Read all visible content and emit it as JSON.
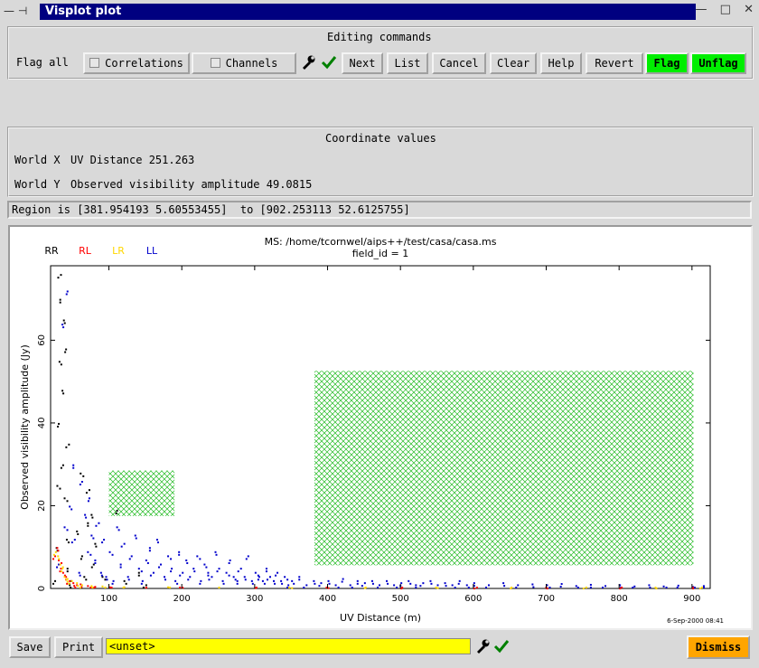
{
  "window": {
    "title": "Visplot plot",
    "left_controls": "— ⊣",
    "right_controls": [
      "—",
      "□",
      "✕"
    ]
  },
  "editing": {
    "heading": "Editing commands",
    "flag_all_label": "Flag all",
    "correlations_label": "Correlations",
    "channels_label": "Channels",
    "buttons": {
      "next": "Next",
      "list": "List",
      "cancel": "Cancel",
      "clear": "Clear",
      "help": "Help",
      "revert": "Revert",
      "flag": "Flag",
      "unflag": "Unflag"
    }
  },
  "coords": {
    "heading": "Coordinate values",
    "world_x_label": "World X",
    "world_x_value": "UV Distance 251.263",
    "world_y_label": "World Y",
    "world_y_value": "Observed visibility amplitude 49.0815"
  },
  "region_text": "Region is [381.954193 5.60553455]  to [902.253113 52.6125755]",
  "chart_data": {
    "type": "scatter",
    "title": "MS: /home/tcornwel/aips++/test/casa/casa.ms",
    "subtitle": "field_id = 1",
    "xlabel": "UV Distance (m)",
    "ylabel": "Observed visibility amplitude (Jy)",
    "xlim": [
      20,
      925
    ],
    "ylim": [
      0,
      78
    ],
    "x_ticks": [
      100,
      200,
      300,
      400,
      500,
      600,
      700,
      800,
      900
    ],
    "y_ticks": [
      0,
      20,
      40,
      60
    ],
    "legend": [
      {
        "name": "RR",
        "color": "#000000"
      },
      {
        "name": "RL",
        "color": "#ff0000"
      },
      {
        "name": "LR",
        "color": "#ffd700"
      },
      {
        "name": "LL",
        "color": "#0000cc"
      }
    ],
    "legend_placement": "top-left",
    "flag_regions": [
      {
        "x": [
          100,
          190
        ],
        "y": [
          17.5,
          28.5
        ]
      },
      {
        "x": [
          382,
          902
        ],
        "y": [
          5.6,
          52.6
        ]
      }
    ],
    "series": [
      {
        "name": "RR",
        "color": "#000000",
        "points": [
          [
            25,
            2
          ],
          [
            27,
            10
          ],
          [
            28,
            25
          ],
          [
            30,
            40
          ],
          [
            31,
            55
          ],
          [
            32,
            70
          ],
          [
            33,
            76
          ],
          [
            35,
            48
          ],
          [
            36,
            30
          ],
          [
            37,
            65
          ],
          [
            38,
            22
          ],
          [
            40,
            58
          ],
          [
            41,
            12
          ],
          [
            42,
            5
          ],
          [
            44,
            35
          ],
          [
            45,
            1
          ],
          [
            47,
            2
          ],
          [
            55,
            14
          ],
          [
            60,
            28
          ],
          [
            62,
            8
          ],
          [
            65,
            3
          ],
          [
            70,
            16
          ],
          [
            72,
            24
          ],
          [
            75,
            18
          ],
          [
            78,
            6
          ],
          [
            80,
            11
          ],
          [
            90,
            3
          ],
          [
            110,
            19
          ],
          [
            120,
            2
          ],
          [
            140,
            4
          ],
          [
            150,
            1
          ]
        ]
      },
      {
        "name": "LL",
        "color": "#0000cc",
        "points": [
          [
            30,
            6
          ],
          [
            35,
            64
          ],
          [
            38,
            15
          ],
          [
            42,
            72
          ],
          [
            45,
            20
          ],
          [
            50,
            30
          ],
          [
            52,
            12
          ],
          [
            58,
            4
          ],
          [
            62,
            26
          ],
          [
            66,
            18
          ],
          [
            70,
            9
          ],
          [
            72,
            22
          ],
          [
            75,
            13
          ],
          [
            80,
            7
          ],
          [
            85,
            16
          ],
          [
            88,
            4
          ],
          [
            92,
            12
          ],
          [
            95,
            3
          ],
          [
            100,
            9
          ],
          [
            105,
            2
          ],
          [
            110,
            15
          ],
          [
            115,
            6
          ],
          [
            120,
            11
          ],
          [
            125,
            3
          ],
          [
            130,
            8
          ],
          [
            135,
            13
          ],
          [
            140,
            5
          ],
          [
            145,
            2
          ],
          [
            150,
            7
          ],
          [
            155,
            10
          ],
          [
            160,
            4
          ],
          [
            165,
            12
          ],
          [
            170,
            6
          ],
          [
            175,
            3
          ],
          [
            180,
            8
          ],
          [
            185,
            5
          ],
          [
            190,
            2
          ],
          [
            195,
            9
          ],
          [
            200,
            4
          ],
          [
            205,
            7
          ],
          [
            210,
            3
          ],
          [
            215,
            5
          ],
          [
            220,
            8
          ],
          [
            225,
            2
          ],
          [
            230,
            6
          ],
          [
            235,
            4
          ],
          [
            240,
            3
          ],
          [
            245,
            9
          ],
          [
            250,
            5
          ],
          [
            255,
            2
          ],
          [
            260,
            4
          ],
          [
            265,
            7
          ],
          [
            270,
            3
          ],
          [
            275,
            2
          ],
          [
            280,
            5
          ],
          [
            285,
            3
          ],
          [
            290,
            8
          ],
          [
            295,
            2
          ],
          [
            300,
            4
          ],
          [
            305,
            3
          ],
          [
            310,
            2
          ],
          [
            315,
            5
          ],
          [
            320,
            3
          ],
          [
            325,
            2
          ],
          [
            330,
            4
          ],
          [
            335,
            2
          ],
          [
            340,
            3
          ],
          [
            345,
            1
          ],
          [
            350,
            2
          ],
          [
            360,
            3
          ],
          [
            370,
            1
          ],
          [
            380,
            2
          ],
          [
            390,
            1.5
          ],
          [
            400,
            2
          ],
          [
            410,
            1
          ],
          [
            420,
            2.5
          ],
          [
            430,
            1
          ],
          [
            440,
            2
          ],
          [
            450,
            1.5
          ],
          [
            460,
            2
          ],
          [
            470,
            1
          ],
          [
            480,
            2
          ],
          [
            490,
            1
          ],
          [
            500,
            1.5
          ],
          [
            510,
            2
          ],
          [
            520,
            1
          ],
          [
            530,
            1.5
          ],
          [
            540,
            2
          ],
          [
            550,
            1
          ],
          [
            560,
            1.5
          ],
          [
            570,
            1
          ],
          [
            580,
            2
          ],
          [
            590,
            1
          ],
          [
            600,
            1.5
          ],
          [
            620,
            1
          ],
          [
            640,
            1.5
          ],
          [
            660,
            1
          ],
          [
            680,
            1.2
          ],
          [
            700,
            1
          ],
          [
            720,
            1.3
          ],
          [
            740,
            0.8
          ],
          [
            760,
            1.1
          ],
          [
            780,
            0.8
          ],
          [
            800,
            1
          ],
          [
            820,
            0.7
          ],
          [
            840,
            1
          ],
          [
            860,
            0.7
          ],
          [
            880,
            0.9
          ],
          [
            900,
            0.6
          ],
          [
            915,
            0.8
          ]
        ]
      },
      {
        "name": "RL",
        "color": "#ff0000",
        "points": [
          [
            25,
            8
          ],
          [
            28,
            10
          ],
          [
            30,
            7
          ],
          [
            33,
            5
          ],
          [
            36,
            4
          ],
          [
            40,
            3
          ],
          [
            45,
            2
          ],
          [
            50,
            1.5
          ],
          [
            55,
            1
          ],
          [
            60,
            1.2
          ],
          [
            70,
            0.8
          ],
          [
            80,
            0.6
          ],
          [
            100,
            0.5
          ],
          [
            150,
            0.4
          ],
          [
            200,
            0.4
          ],
          [
            300,
            0.3
          ],
          [
            400,
            0.3
          ],
          [
            500,
            0.2
          ],
          [
            600,
            0.2
          ],
          [
            700,
            0.2
          ],
          [
            800,
            0.2
          ],
          [
            900,
            0.2
          ]
        ]
      },
      {
        "name": "LR",
        "color": "#ffd700",
        "points": [
          [
            26,
            9
          ],
          [
            29,
            8
          ],
          [
            32,
            6
          ],
          [
            35,
            5
          ],
          [
            38,
            3
          ],
          [
            42,
            2.5
          ],
          [
            48,
            2
          ],
          [
            55,
            1.5
          ],
          [
            62,
            1
          ],
          [
            75,
            0.8
          ],
          [
            90,
            0.7
          ],
          [
            120,
            0.5
          ],
          [
            180,
            0.5
          ],
          [
            250,
            0.4
          ],
          [
            350,
            0.3
          ],
          [
            450,
            0.3
          ],
          [
            550,
            0.3
          ],
          [
            650,
            0.2
          ],
          [
            750,
            0.2
          ],
          [
            850,
            0.2
          ],
          [
            910,
            0.2
          ]
        ]
      }
    ]
  },
  "timestamp": "6-Sep-2000 08:41",
  "bottom": {
    "save": "Save",
    "print": "Print",
    "entry_value": "<unset>",
    "dismiss": "Dismiss"
  }
}
